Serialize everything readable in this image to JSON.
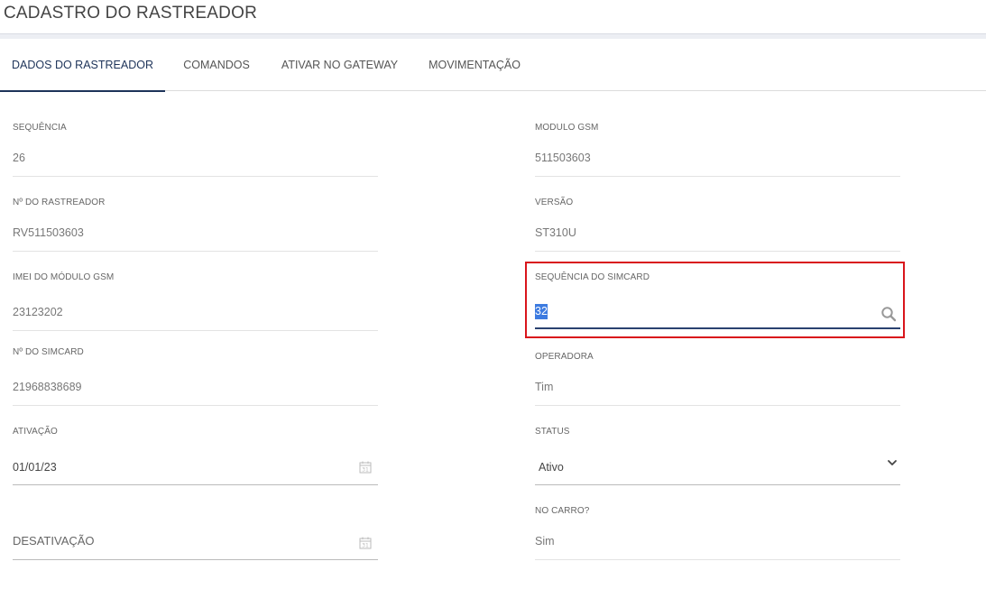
{
  "page": {
    "title": "CADASTRO DO RASTREADOR"
  },
  "tabs": [
    {
      "label": "DADOS DO RASTREADOR",
      "active": true
    },
    {
      "label": "COMANDOS",
      "active": false
    },
    {
      "label": "ATIVAR NO GATEWAY",
      "active": false
    },
    {
      "label": "MOVIMENTAÇÃO",
      "active": false
    }
  ],
  "form": {
    "sequencia": {
      "label": "SEQUÊNCIA",
      "value": "26"
    },
    "numero_rastreador": {
      "label": "Nº DO RASTREADOR",
      "value": "RV511503603"
    },
    "imei": {
      "label": "IMEI DO MÓDULO GSM",
      "value": "23123202"
    },
    "numero_simcard": {
      "label": "Nº DO SIMCARD",
      "value": "21968838689"
    },
    "ativacao": {
      "label": "ATIVAÇÃO",
      "value": "01/01/23",
      "icon": "calendar-icon"
    },
    "desativacao": {
      "placeholder": "DESATIVAÇÃO",
      "icon": "calendar-icon"
    },
    "modulo_gsm": {
      "label": "MODULO GSM",
      "value": "511503603"
    },
    "versao": {
      "label": "VERSÃO",
      "value": "ST310U"
    },
    "sequencia_simcard": {
      "label": "SEQUÊNCIA DO SIMCARD",
      "value": "32",
      "icon": "search-icon"
    },
    "operadora": {
      "label": "OPERADORA",
      "value": "Tim"
    },
    "status": {
      "label": "STATUS",
      "value": "Ativo",
      "icon": "chevron-down-icon"
    },
    "no_carro": {
      "label": "NO CARRO?",
      "value": "Sim"
    }
  },
  "colors": {
    "accent": "#1d3359",
    "highlight_border": "#d9151c",
    "selection": "#3d7be0"
  }
}
